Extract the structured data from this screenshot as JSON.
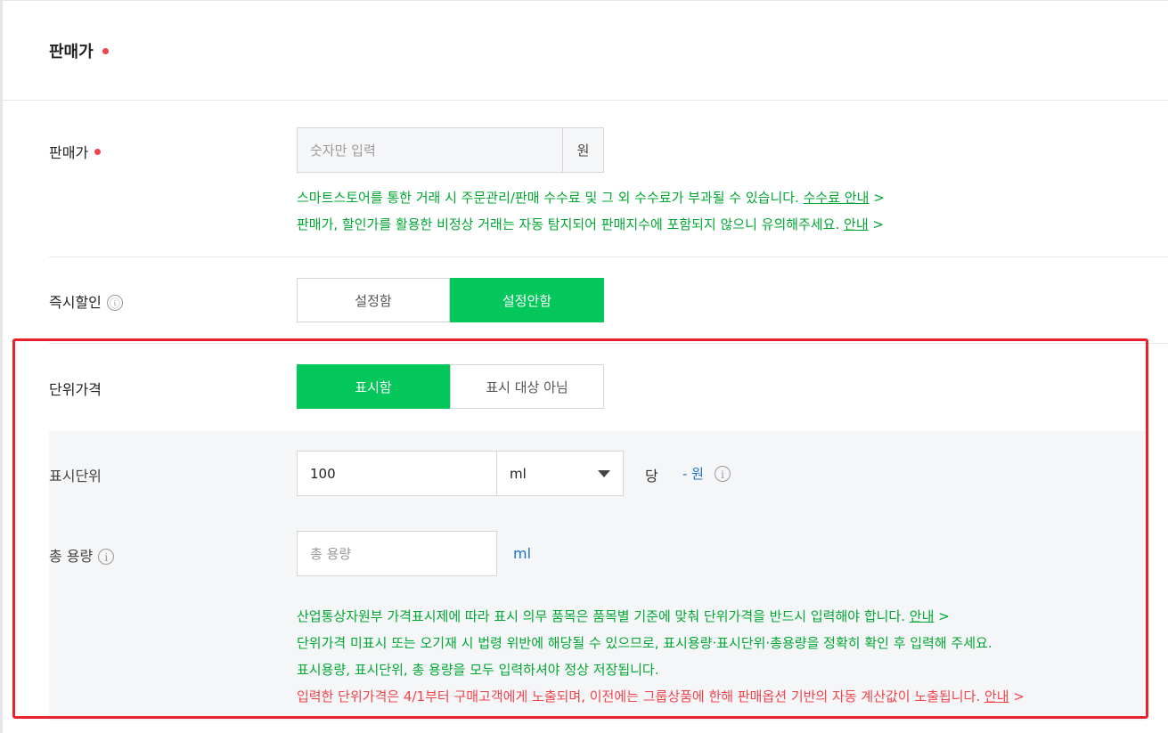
{
  "section": {
    "title": "판매가"
  },
  "price": {
    "label": "판매가",
    "placeholder": "숫자만 입력",
    "unit": "원",
    "notice1_text": "스마트스토어를 통한 거래 시 주문관리/판매 수수료 및 그 외 수수료가 부과될 수 있습니다.",
    "notice1_link": "수수료 안내",
    "notice2_text": "판매가, 할인가를 활용한 비정상 거래는 자동 탐지되어 판매지수에 포함되지 않으니 유의해주세요.",
    "notice2_link": "안내",
    "link_arrow": ">"
  },
  "instant_discount": {
    "label": "즉시할인",
    "info_icon": "ⓘ",
    "options": [
      "설정함",
      "설정안함"
    ],
    "selected": "설정안함"
  },
  "unit_price": {
    "label": "단위가격",
    "options": [
      "표시함",
      "표시 대상 아님"
    ],
    "selected": "표시함"
  },
  "display_unit": {
    "label": "표시단위",
    "value": "100",
    "select_value": "ml",
    "per": "당",
    "price_text": "- 원"
  },
  "total_volume": {
    "label": "총 용량",
    "placeholder": "총 용량",
    "unit": "ml"
  },
  "unit_notices": {
    "line1_text": "산업통상자원부 가격표시제에 따라 표시 의무 품목은 품목별 기준에 맞춰 단위가격을 반드시 입력해야 합니다.",
    "line1_link": "안내",
    "line2_text": "단위가격 미표시 또는 오기재 시 법령 위반에 해당될 수 있으므로, 표시용량·표시단위·총용량을 정확히 확인 후 입력해 주세요.",
    "line3_text": "표시용량, 표시단위, 총 용량을 모두 입력하셔야 정상 저장됩니다.",
    "line4_text": "입력한 단위가격은 4/1부터 구매고객에게 노출되며, 이전에는 그룹상품에 한해 판매옵션 기반의 자동 계산값이 노출됩니다.",
    "line4_link": "안내"
  },
  "colors": {
    "accent_green": "#03c75a",
    "notice_green": "#00a832",
    "warning_red": "#f0444b",
    "highlight_red": "#e8222e",
    "link_blue": "#1a73c8"
  }
}
